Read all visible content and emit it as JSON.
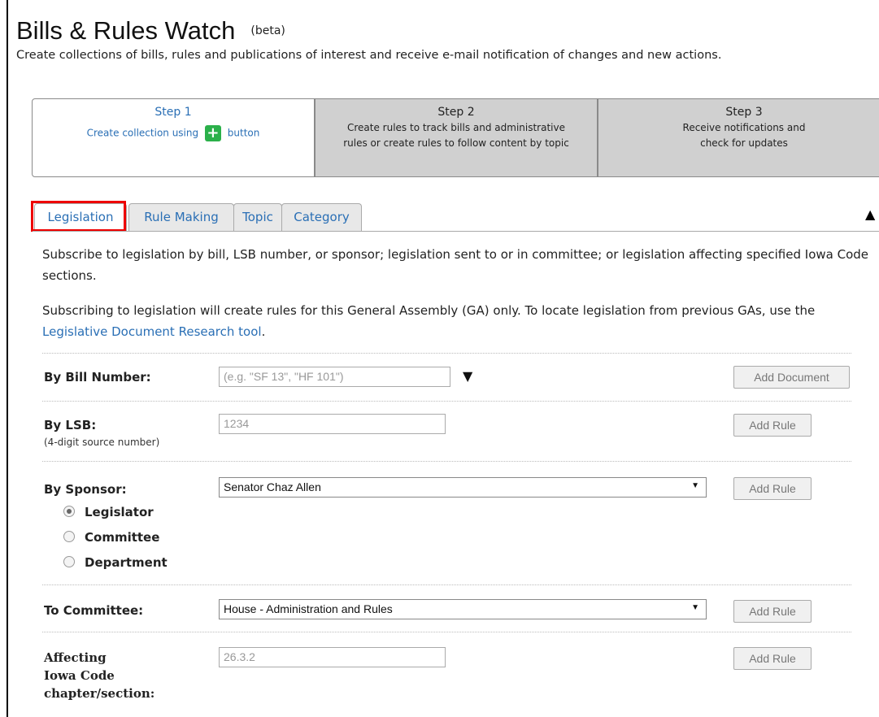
{
  "header": {
    "title": "Bills & Rules Watch",
    "badge": "(beta)",
    "subtitle": "Create collections of bills, rules and publications of interest and receive e-mail notification of changes and new actions."
  },
  "steps": [
    {
      "title": "Step 1",
      "desc_before": "Create collection using",
      "desc_after": "button"
    },
    {
      "title": "Step 2",
      "desc": "Create rules to track bills and administrative rules or create rules to follow content by topic"
    },
    {
      "title": "Step 3",
      "desc": "Receive notifications and check for updates"
    }
  ],
  "tabs": [
    {
      "label": "Legislation",
      "active": true
    },
    {
      "label": "Rule Making",
      "active": false
    },
    {
      "label": "Topic",
      "active": false
    },
    {
      "label": "Category",
      "active": false
    }
  ],
  "intro": {
    "para1": "Subscribe to legislation by bill, LSB number, or sponsor; legislation sent to or in committee; or legislation affecting specified Iowa Code sections.",
    "para2_before": "Subscribing to legislation will create rules for this General Assembly (GA) only. To locate legislation from previous GAs, use the",
    "para2_link": "Legislative Document Research tool",
    "para2_after": "."
  },
  "form": {
    "bill": {
      "label": "By Bill Number:",
      "placeholder": "(e.g. \"SF 13\", \"HF 101\")",
      "button": "Add Document"
    },
    "lsb": {
      "label": "By LSB:",
      "sublabel": "(4-digit source number)",
      "placeholder": "1234",
      "button": "Add Rule"
    },
    "sponsor": {
      "label": "By Sponsor:",
      "selected": "Senator Chaz Allen",
      "button": "Add Rule",
      "options": [
        {
          "label": "Legislator",
          "checked": true
        },
        {
          "label": "Committee",
          "checked": false
        },
        {
          "label": "Department",
          "checked": false
        }
      ]
    },
    "committee": {
      "label": "To Committee:",
      "selected": "House - Administration and Rules",
      "button": "Add Rule"
    },
    "code": {
      "label_line1": "Affecting",
      "label_line2": "Iowa Code",
      "label_line3": "chapter/section:",
      "placeholder": "26.3.2",
      "button": "Add Rule"
    }
  },
  "icons": {
    "add": "plus-icon",
    "collapse": "triangle-up-icon",
    "dropdown": "triangle-down-icon"
  },
  "colors": {
    "link": "#2a6fb5",
    "add_icon": "#2bb04a",
    "highlight": "#e00000"
  }
}
